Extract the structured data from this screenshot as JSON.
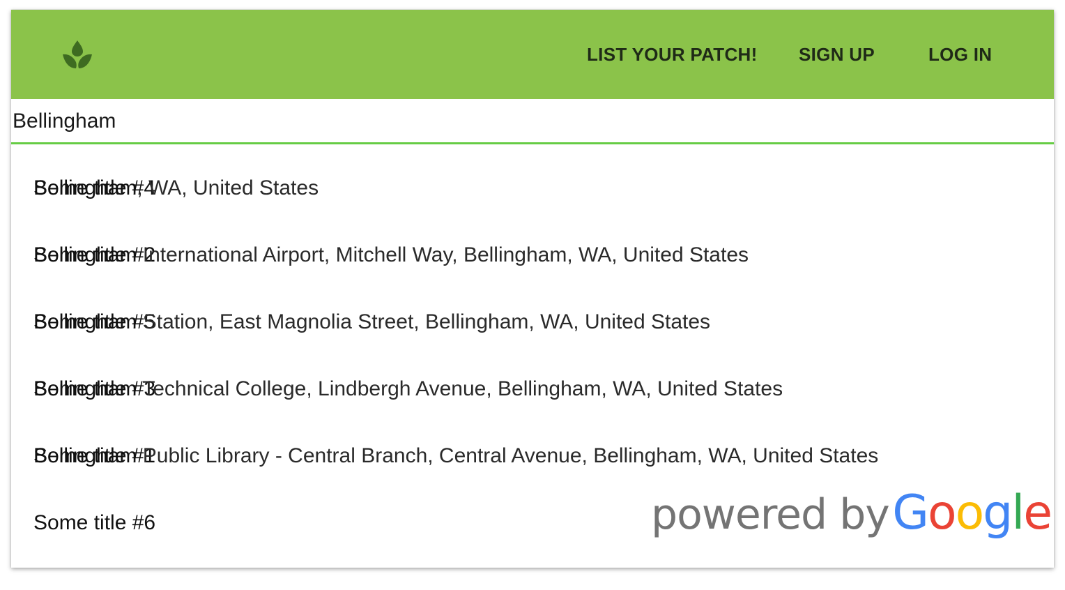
{
  "header": {
    "logo_icon": "sprout-icon",
    "nav": [
      {
        "label": "LIST YOUR PATCH!"
      },
      {
        "label": "SIGN UP"
      },
      {
        "label": "LOG IN"
      }
    ],
    "bg_color": "#8bc34a"
  },
  "search": {
    "value": "Bellingham",
    "underline_color": "#66cc44"
  },
  "results": [
    {
      "title": "Some title #4",
      "highlight": "Bellingham",
      "rest": ", WA, United States"
    },
    {
      "title": "Some title #2",
      "highlight": "Bellingham",
      "rest": " International Airport, Mitchell Way, Bellingham, WA, United States"
    },
    {
      "title": "Some title #5",
      "highlight": "Bellingham",
      "rest": " Station, East Magnolia Street, Bellingham, WA, United States"
    },
    {
      "title": "Some title #3",
      "highlight": "Bellingham",
      "rest": " Technical College, Lindbergh Avenue, Bellingham, WA, United States"
    },
    {
      "title": "Some title #1",
      "highlight": "Bellingham",
      "rest": " Public Library - Central Branch, Central Avenue, Bellingham, WA, United States"
    }
  ],
  "last_row": {
    "title": "Some title #6"
  },
  "attribution": {
    "prefix": "powered by",
    "brand_letters": [
      "G",
      "o",
      "o",
      "g",
      "l",
      "e"
    ],
    "brand_colors": [
      "#4285f4",
      "#ea4335",
      "#fbbc05",
      "#4285f4",
      "#34a853",
      "#ea4335"
    ]
  }
}
